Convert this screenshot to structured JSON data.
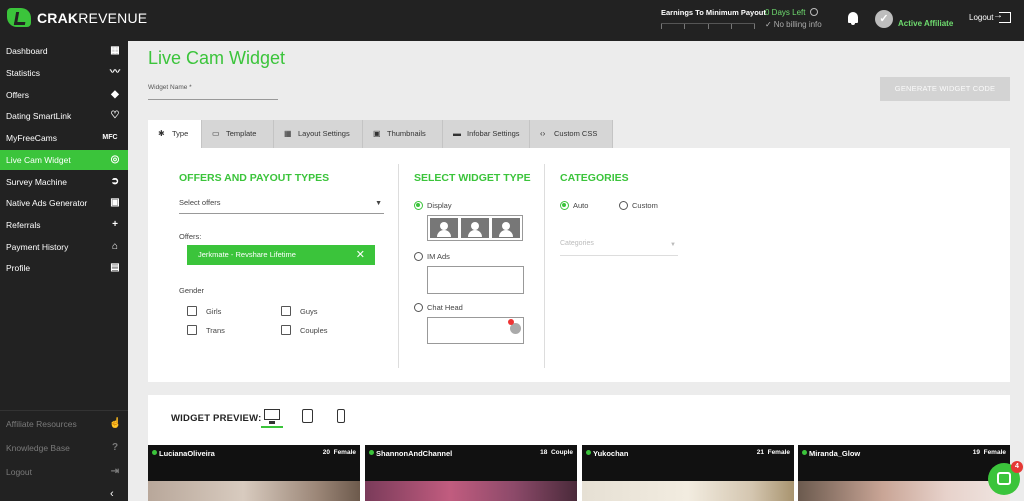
{
  "brand": {
    "name_bold": "CRAK",
    "name_light": "REVENUE"
  },
  "topbar": {
    "earnings_label": "Earnings To Minimum Payout",
    "days_left": "0 Days Left",
    "billing": "No billing info",
    "status": "Active Affiliate",
    "logout": "Logout"
  },
  "sidebar": {
    "items": [
      {
        "label": "Dashboard",
        "icon": "dashboard-grid-icon"
      },
      {
        "label": "Statistics",
        "icon": "trend-icon"
      },
      {
        "label": "Offers",
        "icon": "tag-icon"
      },
      {
        "label": "Dating SmartLink",
        "icon": "heart-icon"
      },
      {
        "label": "MyFreeCams",
        "icon": "mfc-icon",
        "glyph": "MFC"
      },
      {
        "label": "Live Cam Widget",
        "icon": "webcam-icon"
      },
      {
        "label": "Survey Machine",
        "icon": "survey-icon"
      },
      {
        "label": "Native Ads Generator",
        "icon": "native-ads-icon"
      },
      {
        "label": "Referrals",
        "icon": "add-user-icon"
      },
      {
        "label": "Payment History",
        "icon": "bank-icon"
      },
      {
        "label": "Profile",
        "icon": "profile-card-icon"
      }
    ],
    "bottom": [
      {
        "label": "Affiliate Resources",
        "icon": "thumbs-up-icon"
      },
      {
        "label": "Knowledge Base",
        "icon": "help-icon"
      },
      {
        "label": "Logout",
        "icon": "logout-icon"
      }
    ]
  },
  "main": {
    "title": "Live Cam Widget",
    "widget_name_label": "Widget Name *",
    "generate_button": "GENERATE WIDGET CODE",
    "tabs": [
      {
        "label": "Type",
        "icon": "gear-icon"
      },
      {
        "label": "Template",
        "icon": "template-icon"
      },
      {
        "label": "Layout Settings",
        "icon": "layout-grid-icon"
      },
      {
        "label": "Thumbnails",
        "icon": "thumbnail-icon"
      },
      {
        "label": "Infobar Settings",
        "icon": "infobar-icon"
      },
      {
        "label": "Custom CSS",
        "icon": "code-icon"
      }
    ],
    "offers_section": {
      "title": "OFFERS AND PAYOUT TYPES",
      "select_placeholder": "Select offers",
      "offers_label": "Offers:",
      "selected_offer": "Jerkmate - Revshare Lifetime",
      "gender_label": "Gender",
      "genders": [
        "Girls",
        "Guys",
        "Trans",
        "Couples"
      ]
    },
    "widget_type_section": {
      "title": "SELECT WIDGET TYPE",
      "options": [
        "Display",
        "IM Ads",
        "Chat Head"
      ],
      "selected": "Display"
    },
    "categories_section": {
      "title": "CATEGORIES",
      "options": [
        "Auto",
        "Custom"
      ],
      "selected": "Auto",
      "select_placeholder": "Categories"
    },
    "preview": {
      "label": "WIDGET PREVIEW:",
      "devices": [
        "desktop-icon",
        "tablet-icon",
        "mobile-icon"
      ],
      "cams": [
        {
          "name": "LucianaOliveira",
          "age": "20",
          "gender": "Female"
        },
        {
          "name": "ShannonAndChannel",
          "age": "18",
          "gender": "Couple"
        },
        {
          "name": "Yukochan",
          "age": "21",
          "gender": "Female"
        },
        {
          "name": "Miranda_Glow",
          "age": "19",
          "gender": "Female"
        }
      ]
    }
  },
  "chat_widget": {
    "badge": "4"
  },
  "colors": {
    "accent": "#3bc43b",
    "dark": "#222222",
    "page_bg": "#ececec",
    "disabled": "#d3d3d3"
  }
}
